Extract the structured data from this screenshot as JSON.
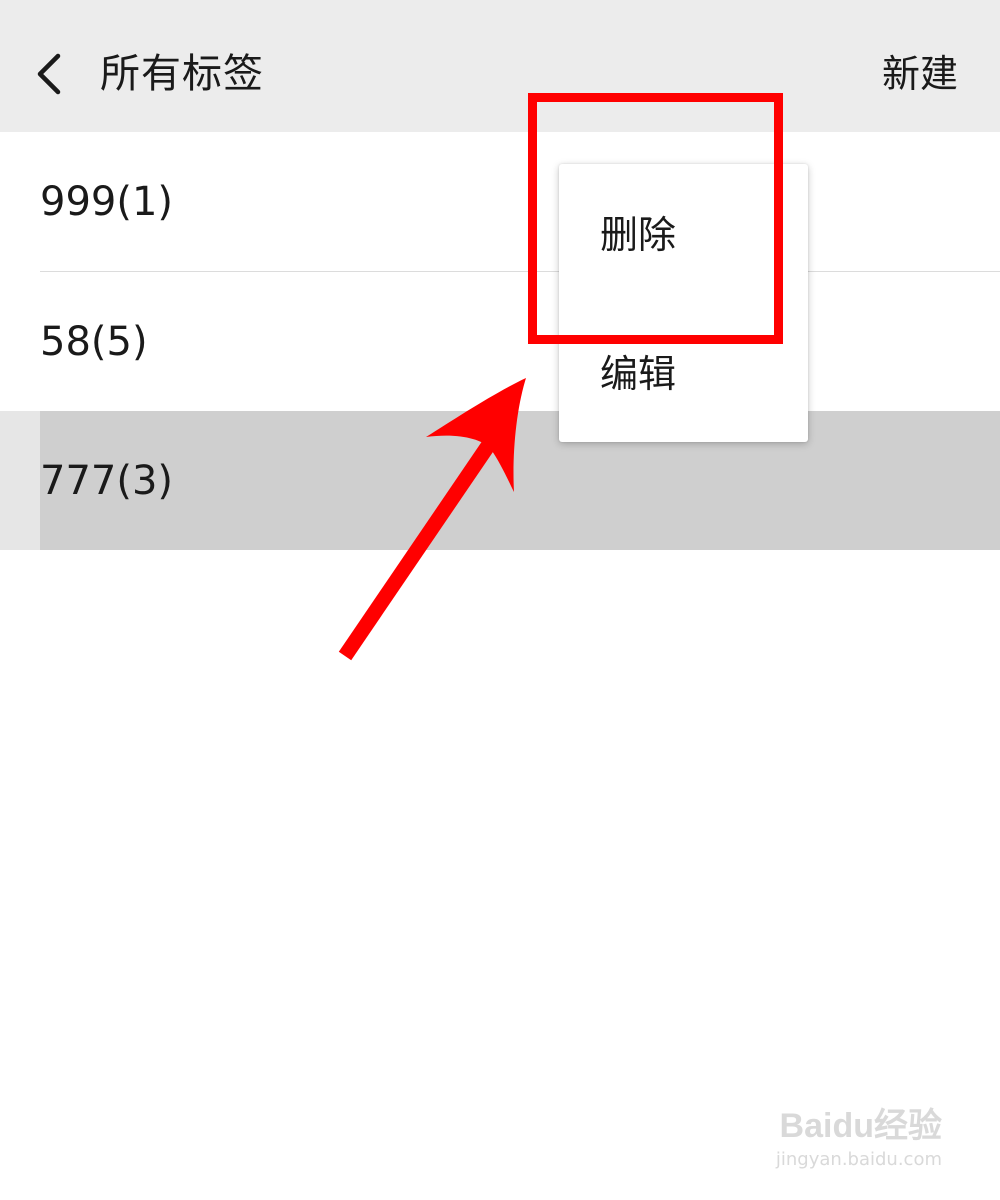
{
  "header": {
    "title": "所有标签",
    "back_icon": "chevron-left-icon",
    "new_label": "新建"
  },
  "tags": [
    {
      "label": "999(1)"
    },
    {
      "label": "58(5)"
    },
    {
      "label": "777(3)",
      "selected": true
    }
  ],
  "context_menu": {
    "items": [
      {
        "label": "删除"
      },
      {
        "label": "编辑"
      }
    ]
  },
  "annotation": {
    "color": "#ff0000",
    "highlighted_item": "删除"
  },
  "watermark": {
    "logo": "Baidu经验",
    "url": "jingyan.baidu.com"
  },
  "colors": {
    "header_bg": "#ececec",
    "selected_row_bg": "#cfcfcf",
    "text": "#1a1a1a"
  }
}
